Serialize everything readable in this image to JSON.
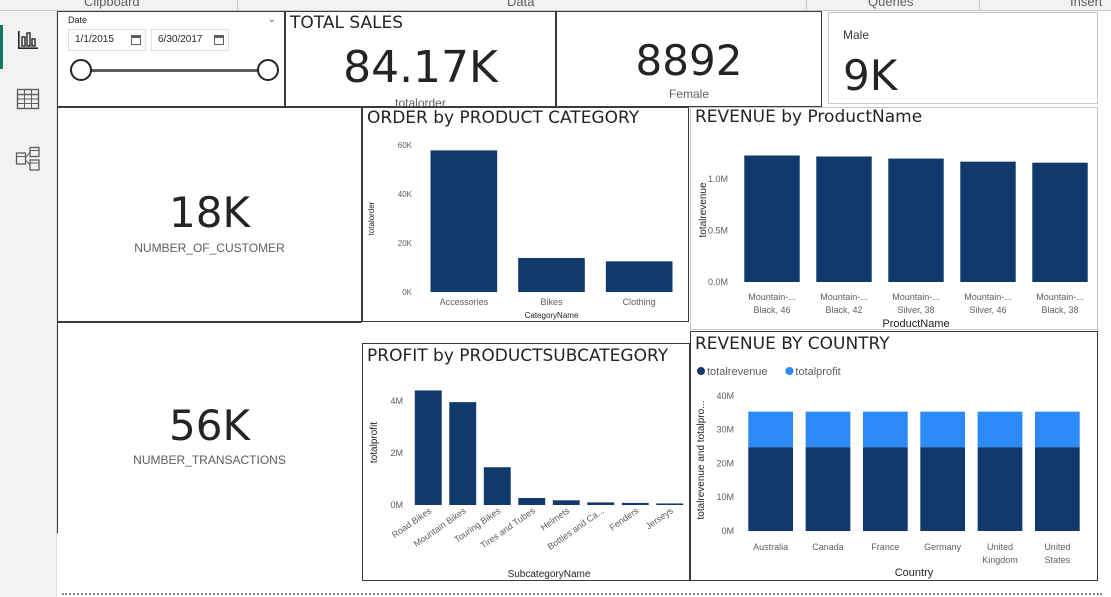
{
  "ribbon": {
    "groups": [
      "Clipboard",
      "Data",
      "Queries",
      "Insert"
    ]
  },
  "rail": {
    "items": [
      {
        "name": "report-view",
        "icon": "bar-chart-icon",
        "active": true
      },
      {
        "name": "table-view",
        "icon": "table-grid-icon",
        "active": false
      },
      {
        "name": "model-view",
        "icon": "model-diagram-icon",
        "active": false
      }
    ]
  },
  "slicer": {
    "title": "Date",
    "start_date": "1/1/2015",
    "end_date": "6/30/2017"
  },
  "kpis": {
    "total_sales": {
      "title": "TOTAL SALES",
      "value": "84.17K",
      "label": "totalorder"
    },
    "female": {
      "value": "8892",
      "label": "Female"
    },
    "male": {
      "label": "Male",
      "value": "9K"
    },
    "customers": {
      "value": "18K",
      "label": "NUMBER_OF_CUSTOMER"
    },
    "transactions": {
      "value": "56K",
      "label": "NUMBER_TRANSACTIONS"
    }
  },
  "colors": {
    "series_dark": "#12396b",
    "series_light": "#2b8af7",
    "axis_text": "#605e5c",
    "gridline": "#e6e6e6",
    "rail_active": "#117865"
  },
  "chart_data": [
    {
      "id": "order_by_category",
      "type": "bar",
      "title": "ORDER by PRODUCT CATEGORY",
      "xlabel": "CategoryName",
      "ylabel": "totalorder",
      "categories": [
        "Accessories",
        "Bikes",
        "Clothing"
      ],
      "values": [
        57800,
        13900,
        12500
      ],
      "ylim": [
        0,
        60000
      ],
      "yticks": [
        0,
        20000,
        40000,
        60000
      ],
      "ytick_labels": [
        "0K",
        "20K",
        "40K",
        "60K"
      ],
      "grid": false
    },
    {
      "id": "revenue_by_product",
      "type": "bar",
      "title": "REVENUE by ProductName",
      "xlabel": "ProductName",
      "ylabel": "totalrevenue",
      "categories": [
        [
          "Mountain-...",
          "Black, 46"
        ],
        [
          "Mountain-...",
          "Black, 42"
        ],
        [
          "Mountain-...",
          "Silver, 38"
        ],
        [
          "Mountain-...",
          "Silver, 46"
        ],
        [
          "Mountain-...",
          "Black, 38"
        ]
      ],
      "values": [
        1230000,
        1220000,
        1200000,
        1170000,
        1160000
      ],
      "ylim": [
        0,
        1400000
      ],
      "yticks": [
        0,
        500000,
        1000000
      ],
      "ytick_labels": [
        "0.0M",
        "0.5M",
        "1.0M"
      ],
      "grid": false
    },
    {
      "id": "profit_by_subcategory",
      "type": "bar",
      "title": "PROFIT by PRODUCTSUBCATEGORY",
      "xlabel": "SubcategoryName",
      "ylabel": "totalprofit",
      "categories": [
        "Road Bikes",
        "Mountain Bikes",
        "Touring Bikes",
        "Tires and Tubes",
        "Helmets",
        "Bottles and Ca...",
        "Fenders",
        "Jerseys"
      ],
      "values": [
        4400000,
        3950000,
        1450000,
        270000,
        180000,
        100000,
        80000,
        60000
      ],
      "ylim": [
        0,
        4800000
      ],
      "yticks": [
        0,
        2000000,
        4000000
      ],
      "ytick_labels": [
        "0M",
        "2M",
        "4M"
      ],
      "grid": false
    },
    {
      "id": "revenue_by_country",
      "type": "bar",
      "stacked": true,
      "title": "REVENUE BY COUNTRY",
      "xlabel": "Country",
      "ylabel": "totalrevenue and totalpro...",
      "legend": "top-left",
      "categories": [
        [
          "Australia"
        ],
        [
          "Canada"
        ],
        [
          "France"
        ],
        [
          "Germany"
        ],
        [
          "United",
          "Kingdom"
        ],
        [
          "United",
          "States"
        ]
      ],
      "series": [
        {
          "name": "totalrevenue",
          "values": [
            24800000,
            24800000,
            24800000,
            24800000,
            24800000,
            24800000
          ]
        },
        {
          "name": "totalprofit",
          "values": [
            10500000,
            10500000,
            10500000,
            10500000,
            10500000,
            10500000
          ]
        }
      ],
      "ylim": [
        0,
        42000000
      ],
      "yticks": [
        0,
        10000000,
        20000000,
        30000000,
        40000000
      ],
      "ytick_labels": [
        "0M",
        "10M",
        "20M",
        "30M",
        "40M"
      ],
      "grid": false
    }
  ]
}
